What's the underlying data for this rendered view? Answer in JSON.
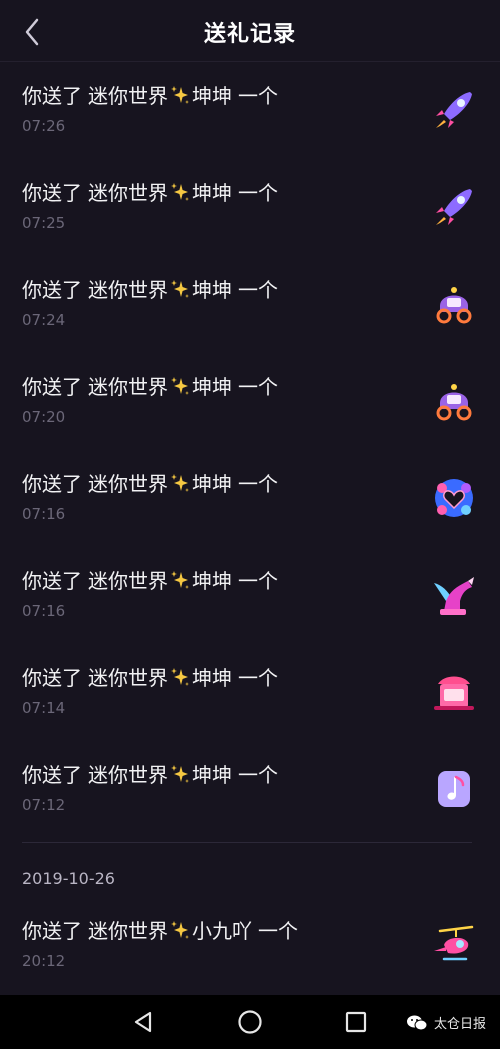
{
  "header": {
    "title": "送礼记录",
    "back_icon": "chevron-left-icon"
  },
  "records": [
    {
      "prefix": "你送了",
      "recipient": "迷你世界",
      "name": "坤坤",
      "suffix": "一个",
      "time": "07:26",
      "gift_icon": "rocket-gift-icon"
    },
    {
      "prefix": "你送了",
      "recipient": "迷你世界",
      "name": "坤坤",
      "suffix": "一个",
      "time": "07:25",
      "gift_icon": "rocket-gift-icon"
    },
    {
      "prefix": "你送了",
      "recipient": "迷你世界",
      "name": "坤坤",
      "suffix": "一个",
      "time": "07:24",
      "gift_icon": "carriage-gift-icon"
    },
    {
      "prefix": "你送了",
      "recipient": "迷你世界",
      "name": "坤坤",
      "suffix": "一个",
      "time": "07:20",
      "gift_icon": "carriage-gift-icon"
    },
    {
      "prefix": "你送了",
      "recipient": "迷你世界",
      "name": "坤坤",
      "suffix": "一个",
      "time": "07:16",
      "gift_icon": "heart-wreath-gift-icon"
    },
    {
      "prefix": "你送了",
      "recipient": "迷你世界",
      "name": "坤坤",
      "suffix": "一个",
      "time": "07:16",
      "gift_icon": "pegasus-gift-icon"
    },
    {
      "prefix": "你送了",
      "recipient": "迷你世界",
      "name": "坤坤",
      "suffix": "一个",
      "time": "07:14",
      "gift_icon": "sedan-gift-icon"
    },
    {
      "prefix": "你送了",
      "recipient": "迷你世界",
      "name": "坤坤",
      "suffix": "一个",
      "time": "07:12",
      "gift_icon": "music-note-gift-icon"
    }
  ],
  "date_separator": "2019-10-26",
  "last_record": {
    "prefix": "你送了",
    "recipient": "迷你世界",
    "name": "小九吖",
    "suffix": "一个",
    "time": "20:12",
    "gift_icon": "helicopter-gift-icon"
  },
  "navbar": {
    "back_icon": "triangle-back-icon",
    "home_icon": "circle-home-icon",
    "recents_icon": "square-recents-icon"
  },
  "watermark": {
    "text": "太仓日报",
    "icon": "wechat-icon"
  },
  "colors": {
    "background": "#17141f",
    "time_text": "#6b6778",
    "sparkle": "#f5c842"
  }
}
